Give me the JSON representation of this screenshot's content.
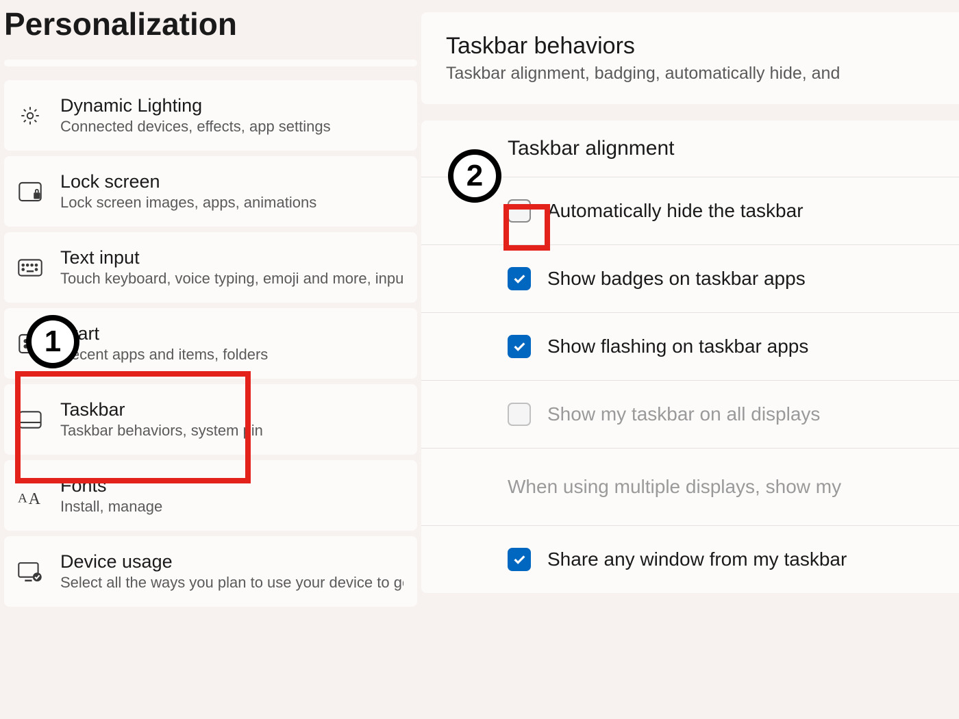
{
  "page": {
    "title": "Personalization"
  },
  "settingsItems": [
    {
      "title": "Dynamic Lighting",
      "subtitle": "Connected devices, effects, app settings"
    },
    {
      "title": "Lock screen",
      "subtitle": "Lock screen images, apps, animations"
    },
    {
      "title": "Text input",
      "subtitle": "Touch keyboard, voice typing, emoji and more, input methods"
    },
    {
      "title": "Start",
      "subtitle": "Recent apps and items, folders"
    },
    {
      "title": "Taskbar",
      "subtitle": "Taskbar behaviors, system pin"
    },
    {
      "title": "Fonts",
      "subtitle": "Install, manage"
    },
    {
      "title": "Device usage",
      "subtitle": "Select all the ways you plan to use your device to get personalized"
    }
  ],
  "behaviors": {
    "title": "Taskbar behaviors",
    "subtitle": "Taskbar alignment, badging, automatically hide, and",
    "alignment_label": "Taskbar alignment",
    "options": {
      "auto_hide": {
        "label": "Automatically hide the taskbar",
        "checked": false
      },
      "badges": {
        "label": "Show badges on taskbar apps",
        "checked": true
      },
      "flashing": {
        "label": "Show flashing on taskbar apps",
        "checked": true
      },
      "all_displays": {
        "label": "Show my taskbar on all displays",
        "checked": false,
        "disabled": true
      },
      "multi_displays_text": "When using multiple displays, show my",
      "share_window": {
        "label": "Share any window from my taskbar",
        "checked": true
      }
    }
  },
  "annotations": {
    "step1": "1",
    "step2": "2"
  }
}
